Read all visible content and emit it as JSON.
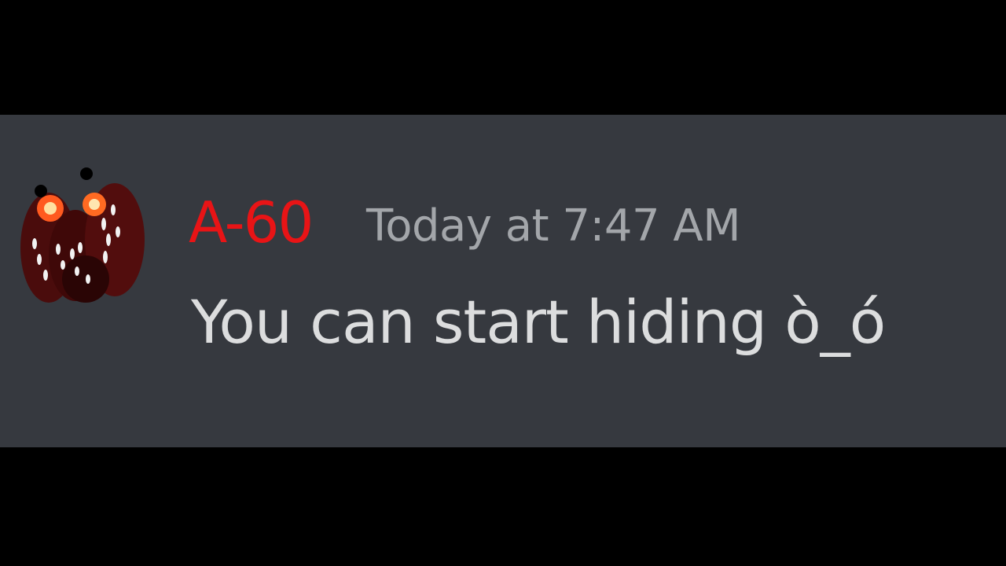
{
  "message": {
    "author": "A-60",
    "timestamp": "Today at 7:47 AM",
    "content": "You can start hiding ò_ó",
    "avatar_icon": "a60-monster-face-icon"
  },
  "colors": {
    "background": "#000000",
    "message_panel": "#36393f",
    "author_name": "#e81416",
    "timestamp": "#a3a6aa",
    "message_text": "#dcddde"
  }
}
